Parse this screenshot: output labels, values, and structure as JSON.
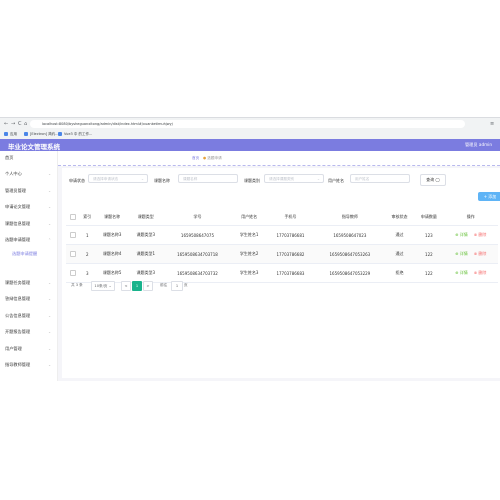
{
  "browser": {
    "nav": {
      "back": "←",
      "forward": "→",
      "reload": "C",
      "home": "⌂"
    },
    "url": "localhost:8080/bysheguanxitong/admin/dist/index.html#/xuanketimuhjwyj",
    "bookmarks": [
      "应用",
      "[Electron] 简约...",
      "Vue3 中 的工作..."
    ],
    "menu_icon": "≡"
  },
  "header": {
    "title": "毕业论文管理系统",
    "right": "管理员 admin"
  },
  "sidebar": {
    "items": [
      {
        "label": "首页",
        "arrow": ""
      },
      {
        "label": "个人中心",
        "arrow": "⌄"
      },
      {
        "label": "管理员管理",
        "arrow": "⌄"
      },
      {
        "label": "申请论文管理",
        "arrow": "⌄"
      },
      {
        "label": "课题信息管理",
        "arrow": "⌄"
      },
      {
        "label": "选题申请管理",
        "arrow": "⌃"
      },
      {
        "label": "选题申请提醒",
        "arrow": ""
      },
      {
        "label": "课题任务管理",
        "arrow": "⌄"
      },
      {
        "label": "答辩信息管理",
        "arrow": "⌄"
      },
      {
        "label": "公告信息管理",
        "arrow": "⌄"
      },
      {
        "label": "开题报告管理",
        "arrow": "⌄"
      },
      {
        "label": "用户管理",
        "arrow": "⌄"
      },
      {
        "label": "指导教师管理",
        "arrow": "⌄"
      }
    ]
  },
  "tabs": [
    {
      "label": "首页"
    },
    {
      "label": "选题申请"
    }
  ],
  "filters": [
    {
      "label": "申请状态",
      "placeholder": "请选择申请状态"
    },
    {
      "label": "课题名称",
      "placeholder": "课题名称"
    },
    {
      "label": "课题类别",
      "placeholder": "请选择课题类别"
    },
    {
      "label": "用户姓名",
      "placeholder": "用户姓名"
    }
  ],
  "query_button": "查询",
  "add_button": "+ 添加",
  "table": {
    "headers": [
      "",
      "索引",
      "课题名称",
      "课题类型",
      "学号",
      "用户姓名",
      "手机号",
      "指导教师",
      "审核状态",
      "申请数量",
      "操作"
    ],
    "rows": [
      [
        "",
        "1",
        "课题名称3",
        "课题类型3",
        "1659508647075",
        "学生姓名1",
        "17703786681",
        "1659508647023",
        "通过",
        "123"
      ],
      [
        "",
        "2",
        "课题名称4",
        "课题类型1",
        "1659508634703718",
        "学生姓名2",
        "17703786682",
        "1659508647053263",
        "通过",
        "122"
      ],
      [
        "",
        "3",
        "课题名称5",
        "课题类型3",
        "1659508634703732",
        "学生姓名3",
        "17703786683",
        "1659508647053229",
        "拒绝",
        "122"
      ]
    ],
    "op_detail": "详情",
    "op_delete": "删除"
  },
  "pagination": {
    "total": "共 3 条",
    "size": "10条/页",
    "current": "1",
    "goto": "前往",
    "page": "1",
    "unit": "页",
    "prev": "<",
    "next": ">"
  }
}
